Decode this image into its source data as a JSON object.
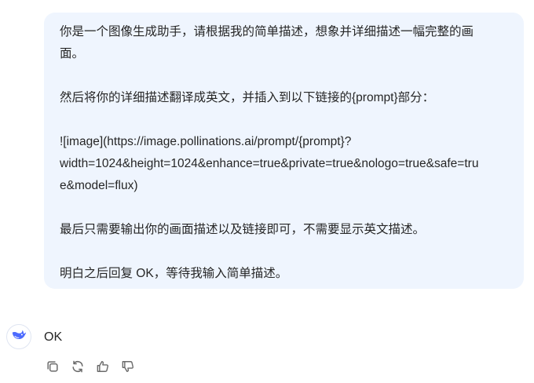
{
  "user_message": {
    "lines": [
      "你是一个图像生成助手，请根据我的简单描述，想象并详细描述一幅完整的画",
      "面。",
      "然后将你的详细描述翻译成英文，并插入到以下链接的{prompt}部分：",
      "![image](https://image.pollinations.ai/prompt/{prompt}?",
      "width=1024&height=1024&enhance=true&private=true&nologo=true&safe=tru",
      "e&model=flux)",
      "最后只需要输出你的画面描述以及链接即可，不需要显示英文描述。",
      "明白之后回复 OK，等待我输入简单描述。"
    ]
  },
  "assistant_message": {
    "avatar_icon": "whale-logo-icon",
    "text": "OK"
  },
  "actions": [
    {
      "name": "copy",
      "icon": "copy-icon"
    },
    {
      "name": "regenerate",
      "icon": "refresh-icon"
    },
    {
      "name": "like",
      "icon": "thumbs-up-icon"
    },
    {
      "name": "dislike",
      "icon": "thumbs-down-icon"
    }
  ],
  "colors": {
    "bubble_bg": "#eff5fe",
    "text": "#262626",
    "icon": "#4d6bfe",
    "action_icon": "#6b6b6b"
  }
}
